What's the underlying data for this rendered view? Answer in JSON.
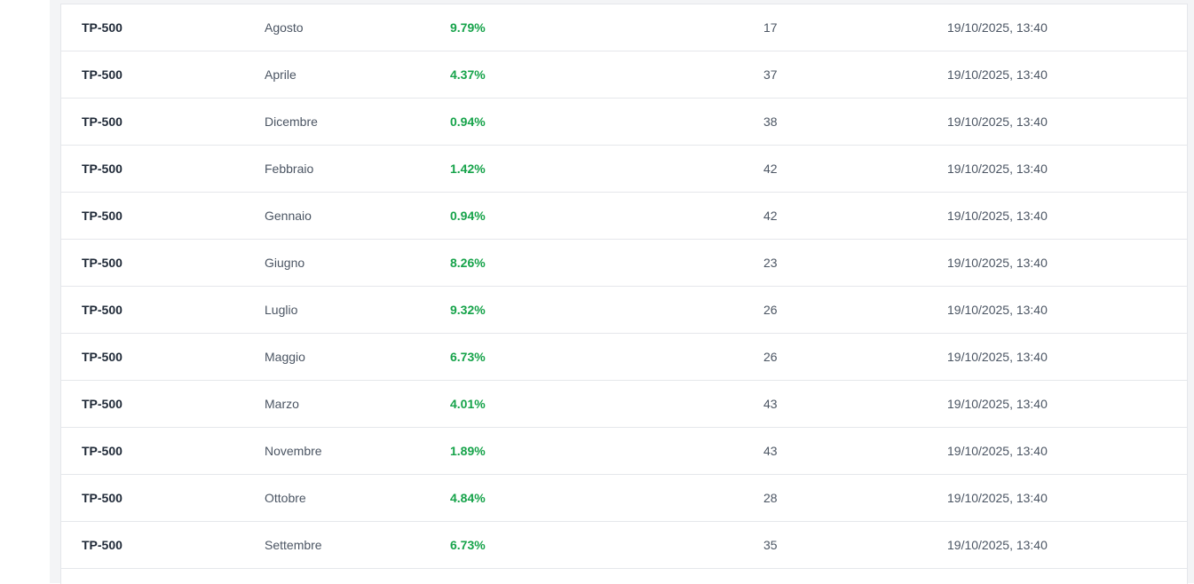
{
  "table": {
    "rows": [
      {
        "code": "TP-500",
        "month": "Agosto",
        "percent": "9.79%",
        "count": "17",
        "timestamp": "19/10/2025, 13:40"
      },
      {
        "code": "TP-500",
        "month": "Aprile",
        "percent": "4.37%",
        "count": "37",
        "timestamp": "19/10/2025, 13:40"
      },
      {
        "code": "TP-500",
        "month": "Dicembre",
        "percent": "0.94%",
        "count": "38",
        "timestamp": "19/10/2025, 13:40"
      },
      {
        "code": "TP-500",
        "month": "Febbraio",
        "percent": "1.42%",
        "count": "42",
        "timestamp": "19/10/2025, 13:40"
      },
      {
        "code": "TP-500",
        "month": "Gennaio",
        "percent": "0.94%",
        "count": "42",
        "timestamp": "19/10/2025, 13:40"
      },
      {
        "code": "TP-500",
        "month": "Giugno",
        "percent": "8.26%",
        "count": "23",
        "timestamp": "19/10/2025, 13:40"
      },
      {
        "code": "TP-500",
        "month": "Luglio",
        "percent": "9.32%",
        "count": "26",
        "timestamp": "19/10/2025, 13:40"
      },
      {
        "code": "TP-500",
        "month": "Maggio",
        "percent": "6.73%",
        "count": "26",
        "timestamp": "19/10/2025, 13:40"
      },
      {
        "code": "TP-500",
        "month": "Marzo",
        "percent": "4.01%",
        "count": "43",
        "timestamp": "19/10/2025, 13:40"
      },
      {
        "code": "TP-500",
        "month": "Novembre",
        "percent": "1.89%",
        "count": "43",
        "timestamp": "19/10/2025, 13:40"
      },
      {
        "code": "TP-500",
        "month": "Ottobre",
        "percent": "4.84%",
        "count": "28",
        "timestamp": "19/10/2025, 13:40"
      },
      {
        "code": "TP-500",
        "month": "Settembre",
        "percent": "6.73%",
        "count": "35",
        "timestamp": "19/10/2025, 13:40"
      }
    ]
  },
  "colors": {
    "percent": "#16a34a",
    "background_gutter": "#f3f4f6",
    "row_border": "#e5e7eb"
  }
}
